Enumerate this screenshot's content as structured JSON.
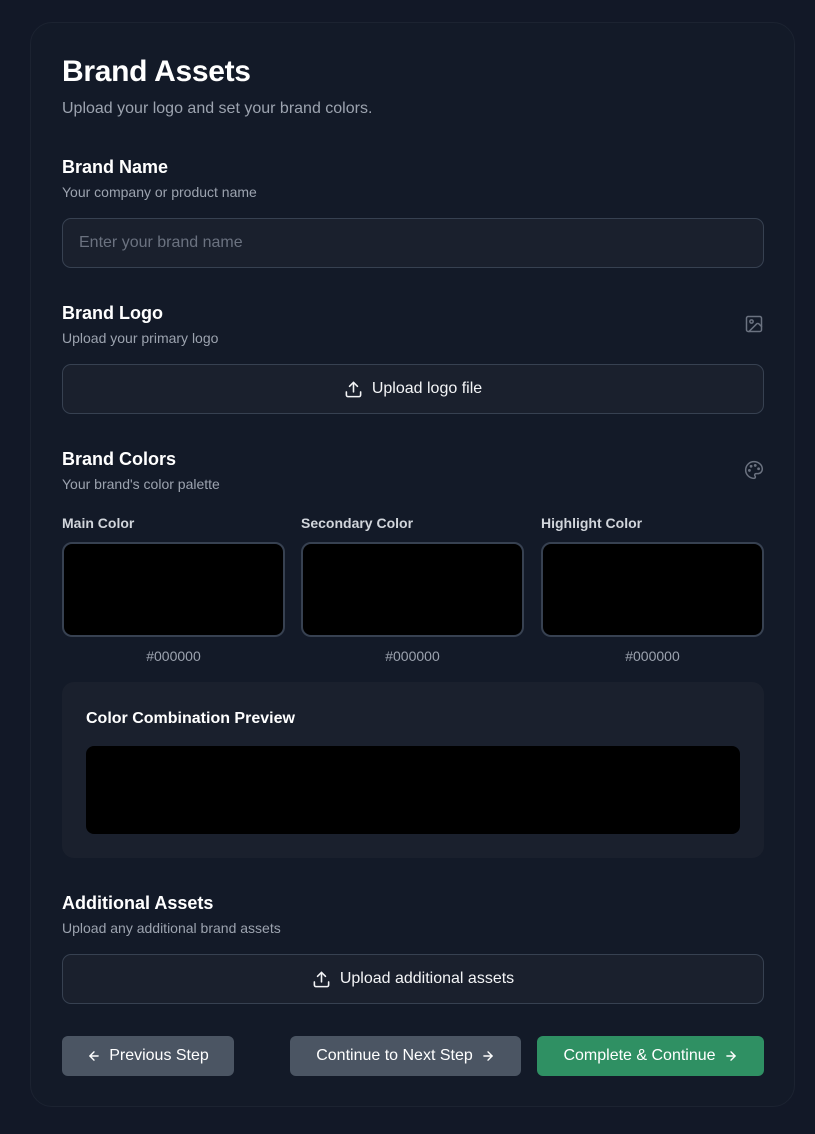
{
  "header": {
    "title": "Brand Assets",
    "subtitle": "Upload your logo and set your brand colors."
  },
  "brand_name": {
    "title": "Brand Name",
    "description": "Your company or product name",
    "placeholder": "Enter your brand name",
    "value": ""
  },
  "brand_logo": {
    "title": "Brand Logo",
    "description": "Upload your primary logo",
    "upload_label": "Upload logo file",
    "icon": "image-icon"
  },
  "brand_colors": {
    "title": "Brand Colors",
    "description": "Your brand's color palette",
    "icon": "palette-icon",
    "colors": [
      {
        "label": "Main Color",
        "hex": "#000000"
      },
      {
        "label": "Secondary Color",
        "hex": "#000000"
      },
      {
        "label": "Highlight Color",
        "hex": "#000000"
      }
    ],
    "preview_title": "Color Combination Preview"
  },
  "additional_assets": {
    "title": "Additional Assets",
    "description": "Upload any additional brand assets",
    "upload_label": "Upload additional assets"
  },
  "footer": {
    "previous_label": "Previous Step",
    "next_label": "Continue to Next Step",
    "complete_label": "Complete & Continue"
  },
  "theme": {
    "background": "#121827",
    "card": "#131a28",
    "input": "#1a202d",
    "secondary_button": "#4b5563",
    "accent": "#2f9063"
  }
}
